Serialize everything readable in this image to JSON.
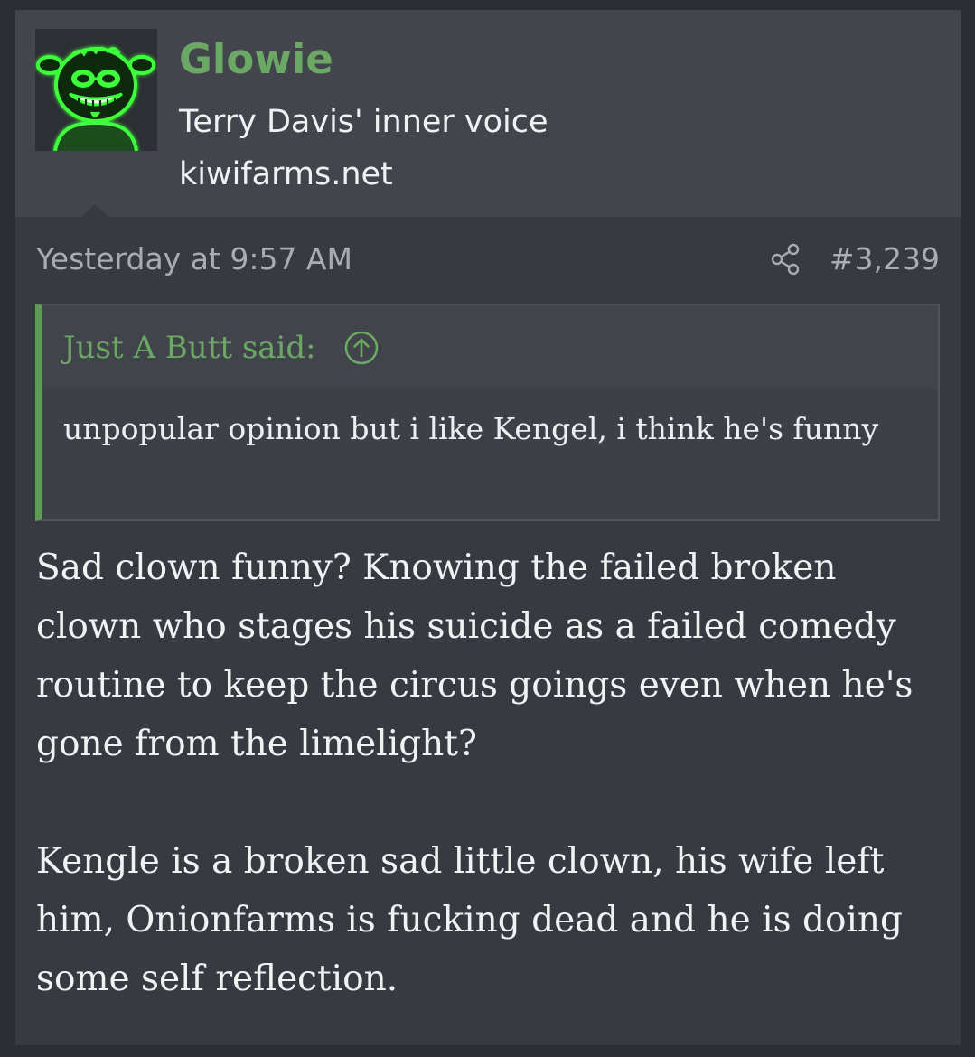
{
  "user": {
    "name": "Glowie",
    "title": "Terry Davis' inner voice",
    "site": "kiwifarms.net",
    "avatar_icon": "glowing-green-grinning-face-avatar"
  },
  "meta": {
    "timestamp": "Yesterday at 9:57 AM",
    "post_number": "#3,239",
    "share_icon": "share-icon"
  },
  "quote": {
    "author": "Just A Butt said:",
    "jump_icon": "arrow-up-circle-icon",
    "body": "unpopular opinion but i like Kengel, i think he's funny"
  },
  "message": {
    "paragraphs": [
      "Sad clown funny? Knowing the failed broken clown who stages his suicide as a failed comedy routine to keep the circus goings even when he's gone from the limelight?",
      "Kengle is a broken sad little clown, his wife left him, Onionfarms is fucking dead and he is doing some self reflection."
    ]
  },
  "colors": {
    "page_bg": "#2a2d32",
    "post_bg": "#373a41",
    "header_bg": "#42454c",
    "accent_green": "#6aa863",
    "quote_border": "#5e9c56",
    "text": "#f1f2f4",
    "muted_text": "#a9acb2"
  }
}
